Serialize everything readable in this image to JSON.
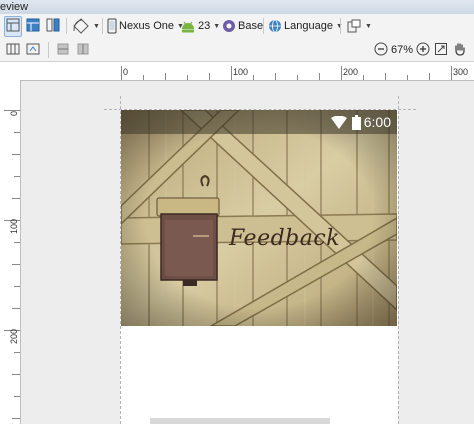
{
  "window": {
    "title": "eview"
  },
  "toolbar1": {
    "device": "Nexus One",
    "api_level": "23",
    "theme": "Base",
    "language": "Language"
  },
  "toolbar2": {
    "zoom": "67%"
  },
  "rulers": {
    "top": [
      "0",
      "100",
      "200",
      "300"
    ],
    "left": [
      "0",
      "100",
      "200"
    ]
  },
  "preview": {
    "status_time": "6:00",
    "feedback_text": "Feedback"
  },
  "colors": {
    "accent": "#3b82c4",
    "statusbar": "#3c3728",
    "wood": "#c8b98c"
  }
}
